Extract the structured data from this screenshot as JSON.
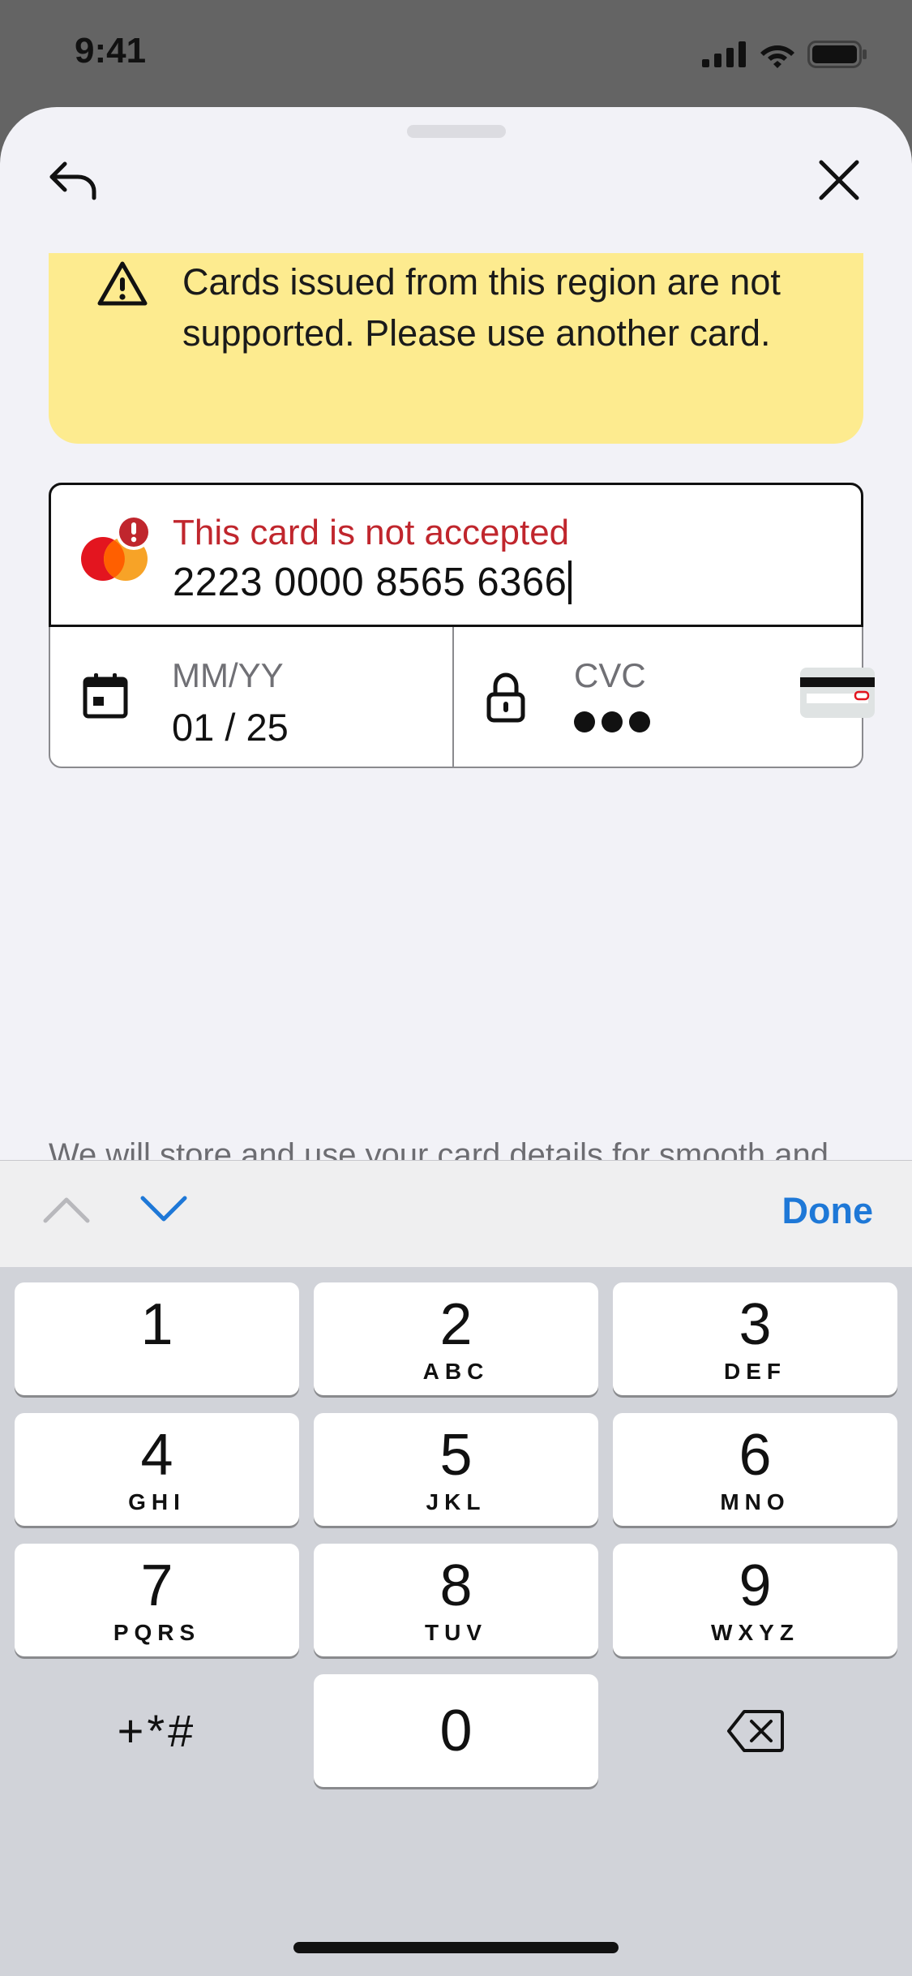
{
  "status_bar": {
    "time": "9:41"
  },
  "banner": {
    "message": "Cards issued from this region are not supported. Please use another card."
  },
  "card_form": {
    "error_label": "This card is not accepted",
    "card_number": "2223 0000 8565 6366",
    "expiry": {
      "label": "MM/YY",
      "value": "01 / 25"
    },
    "cvc": {
      "label": "CVC"
    }
  },
  "disclaimer": "We will store and use your card details for smooth and",
  "accessory": {
    "done_label": "Done"
  },
  "keypad": {
    "keys": [
      {
        "num": "1",
        "letters": ""
      },
      {
        "num": "2",
        "letters": "ABC"
      },
      {
        "num": "3",
        "letters": "DEF"
      },
      {
        "num": "4",
        "letters": "GHI"
      },
      {
        "num": "5",
        "letters": "JKL"
      },
      {
        "num": "6",
        "letters": "MNO"
      },
      {
        "num": "7",
        "letters": "PQRS"
      },
      {
        "num": "8",
        "letters": "TUV"
      },
      {
        "num": "9",
        "letters": "WXYZ"
      },
      {
        "num": "0",
        "letters": ""
      }
    ],
    "symbols_label": "+*#"
  },
  "colors": {
    "error": "#c0262d",
    "accent": "#1e78d7",
    "banner": "#fdeb8f"
  }
}
